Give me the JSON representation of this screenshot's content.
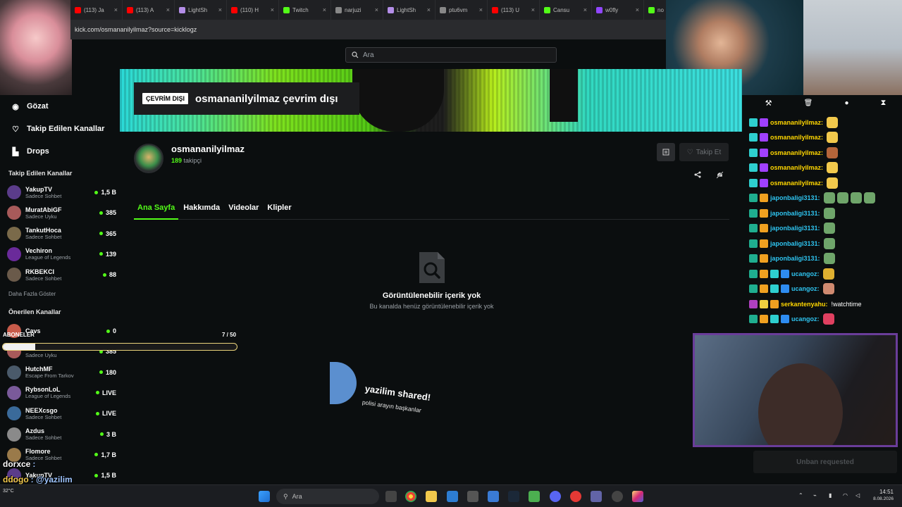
{
  "browser": {
    "tabs": [
      {
        "label": "(113) Ja",
        "color": "#ff0000"
      },
      {
        "label": "(113) A",
        "color": "#ff0000"
      },
      {
        "label": "LightSh",
        "color": "#b48ee8"
      },
      {
        "label": "(110) H",
        "color": "#ff0000"
      },
      {
        "label": "Twitch",
        "color": "#53fc18"
      },
      {
        "label": "narjuzi",
        "color": "#888888"
      },
      {
        "label": "LightSh",
        "color": "#b48ee8"
      },
      {
        "label": "ptu6vm",
        "color": "#888888"
      },
      {
        "label": "(113) U",
        "color": "#ff0000"
      },
      {
        "label": "Cansu",
        "color": "#53fc18"
      },
      {
        "label": "w0fly",
        "color": "#9146ff"
      },
      {
        "label": "no",
        "color": "#53fc18"
      }
    ],
    "url": "kick.com/osmananilyilmaz?source=kicklogz"
  },
  "search": {
    "placeholder": "Ara"
  },
  "nav": {
    "items": [
      {
        "label": "Gözat",
        "icon": "compass-icon"
      },
      {
        "label": "Takip Edilen Kanallar",
        "icon": "heart-icon"
      },
      {
        "label": "Drops",
        "icon": "drops-icon"
      }
    ],
    "followed_title": "Takip Edilen Kanallar",
    "followed": [
      {
        "name": "YakupTV",
        "category": "Sadece Sohbet",
        "count": "1,5 B",
        "avatar": "#5b3c8a"
      },
      {
        "name": "MuratAbiGF",
        "category": "Sadece Uyku",
        "count": "385",
        "avatar": "#a85a5a"
      },
      {
        "name": "TankutHoca",
        "category": "Sadece Sohbet",
        "count": "365",
        "avatar": "#7a6a4a"
      },
      {
        "name": "Vechiron",
        "category": "League of Legends",
        "count": "139",
        "avatar": "#6a2a9a"
      },
      {
        "name": "RKBEKCI",
        "category": "Sadece Sohbet",
        "count": "88",
        "avatar": "#6a5a4a"
      }
    ],
    "more_label": "Daha Fazla Göster",
    "recommended_title": "Önerilen Kanallar",
    "recommended": [
      {
        "name": "Cavs",
        "category": "",
        "count": "0",
        "avatar": "#c75b4a"
      },
      {
        "name": "MuratAbiGF",
        "category": "Sadece Uyku",
        "count": "385",
        "avatar": "#a85a5a"
      },
      {
        "name": "HutchMF",
        "category": "Escape From Tarkov",
        "count": "180",
        "avatar": "#4a5a6a"
      },
      {
        "name": "RybsonLoL",
        "category": "League of Legends",
        "count": "LIVE",
        "avatar": "#7a5a9a"
      },
      {
        "name": "NEEXcsgo",
        "category": "Sadece Sohbet",
        "count": "LIVE",
        "avatar": "#3a6a9a"
      },
      {
        "name": "Azdus",
        "category": "Sadece Sohbet",
        "count": "3 B",
        "avatar": "#8a8a8a"
      },
      {
        "name": "Flomore",
        "category": "Sadece Sohbet",
        "count": "1,7 B",
        "avatar": "#9a7a4a"
      },
      {
        "name": "YakupTV",
        "category": "",
        "count": "1,5 B",
        "avatar": "#5b3c8a"
      }
    ]
  },
  "channel": {
    "offline_badge": "ÇEVRİM DIŞI",
    "offline_title": "osmananilyilmaz çevrim dışı",
    "name": "osmananilyilmaz",
    "followers_count": "189",
    "followers_label": "takipçi",
    "follow_label": "Takip Et",
    "tabs": [
      "Ana Sayfa",
      "Hakkımda",
      "Videolar",
      "Klipler"
    ],
    "empty_title": "Görüntülenebilir içerik yok",
    "empty_subtitle": "Bu kanalda henüz görüntülenebilir içerik yok"
  },
  "share_overlay": {
    "title": "yazilim shared!",
    "subtitle": "polisi arayın başkanlar"
  },
  "subs_overlay": {
    "label": "ABONELER",
    "count": "7 / 50",
    "progress": 0.14
  },
  "chat": {
    "messages": [
      {
        "user": "osmananilyilmaz:",
        "color": "#ffd700",
        "badges": [
          "#2ecfcf",
          "#a040ff"
        ],
        "text": "",
        "emotes": [
          "#f2c94c"
        ]
      },
      {
        "user": "osmananilyilmaz:",
        "color": "#ffd700",
        "badges": [
          "#2ecfcf",
          "#a040ff"
        ],
        "text": "",
        "emotes": [
          "#f2c94c"
        ]
      },
      {
        "user": "osmananilyilmaz:",
        "color": "#ffd700",
        "badges": [
          "#2ecfcf",
          "#a040ff"
        ],
        "text": "",
        "emotes": [
          "#b5653a"
        ]
      },
      {
        "user": "osmananilyilmaz:",
        "color": "#ffd700",
        "badges": [
          "#2ecfcf",
          "#a040ff"
        ],
        "text": "",
        "emotes": [
          "#f2c94c"
        ]
      },
      {
        "user": "osmananilyilmaz:",
        "color": "#ffd700",
        "badges": [
          "#2ecfcf",
          "#a040ff"
        ],
        "text": "",
        "emotes": [
          "#f2c94c"
        ]
      },
      {
        "user": "japonbaligi3131:",
        "color": "#2ec4f0",
        "badges": [
          "#1fae8f",
          "#f0a020"
        ],
        "text": "",
        "emotes": [
          "#6fa56a",
          "#6fa56a",
          "#6fa56a",
          "#6fa56a"
        ]
      },
      {
        "user": "japonbaligi3131:",
        "color": "#2ec4f0",
        "badges": [
          "#1fae8f",
          "#f0a020"
        ],
        "text": "",
        "emotes": [
          "#6fa56a"
        ]
      },
      {
        "user": "japonbaligi3131:",
        "color": "#2ec4f0",
        "badges": [
          "#1fae8f",
          "#f0a020"
        ],
        "text": "",
        "emotes": [
          "#6fa56a"
        ]
      },
      {
        "user": "japonbaligi3131:",
        "color": "#2ec4f0",
        "badges": [
          "#1fae8f",
          "#f0a020"
        ],
        "text": "",
        "emotes": [
          "#6fa56a"
        ]
      },
      {
        "user": "japonbaligi3131:",
        "color": "#2ec4f0",
        "badges": [
          "#1fae8f",
          "#f0a020"
        ],
        "text": "",
        "emotes": [
          "#6fa56a"
        ]
      },
      {
        "user": "ucangoz:",
        "color": "#2ec4f0",
        "badges": [
          "#1fae8f",
          "#f0a020",
          "#2ecfcf",
          "#2e8cf0"
        ],
        "text": "",
        "emotes": [
          "#e0b030"
        ]
      },
      {
        "user": "ucangoz:",
        "color": "#2ec4f0",
        "badges": [
          "#1fae8f",
          "#f0a020",
          "#2ecfcf",
          "#2e8cf0"
        ],
        "text": "",
        "emotes": [
          "#d08a70"
        ]
      },
      {
        "user": "serkantenyahu:",
        "color": "#ffd700",
        "badges": [
          "#b040c0",
          "#f0d040",
          "#f0a020"
        ],
        "text": "!watchtime",
        "emotes": []
      },
      {
        "user": "ucangoz:",
        "color": "#2ec4f0",
        "badges": [
          "#1fae8f",
          "#f0a020",
          "#2ecfcf",
          "#2e8cf0"
        ],
        "text": "",
        "emotes": [
          "#e04060"
        ]
      }
    ],
    "unban_label": "Unban requested"
  },
  "overlay_chat": [
    {
      "user": "dorxce",
      "text": ":"
    },
    {
      "user": "ddogo",
      "text": ": @yazilim"
    },
    {
      "user": "ddogo",
      "text": ":"
    }
  ],
  "taskbar": {
    "search_placeholder": "Ara",
    "weather": "32°C",
    "time": "14:51",
    "date": "8.08.2026"
  }
}
